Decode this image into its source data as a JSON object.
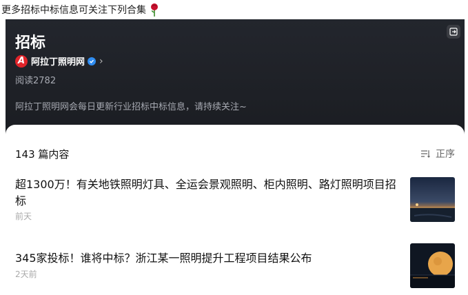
{
  "top_note": "更多招标中标信息可关注下列合集",
  "header": {
    "title": "招标",
    "account_name": "阿拉丁照明网",
    "logo_letter": "A",
    "reads": "阅读2782",
    "description": "阿拉丁照明网会每日更新行业招标中标信息，请持续关注~"
  },
  "list": {
    "count": "143 篇内容",
    "sort_label": "正序",
    "articles": [
      {
        "title": "超1300万！有关地铁照明灯具、全运会景观照明、柜内照明、路灯照明项目招标",
        "time": "前天"
      },
      {
        "title": "345家投标！谁将中标？浙江某一照明提升工程项目结果公布",
        "time": "2天前"
      }
    ]
  },
  "colors": {
    "header_bg": "#1f2127",
    "brand_red": "#e0242a",
    "verified_blue": "#2f8cf0"
  }
}
